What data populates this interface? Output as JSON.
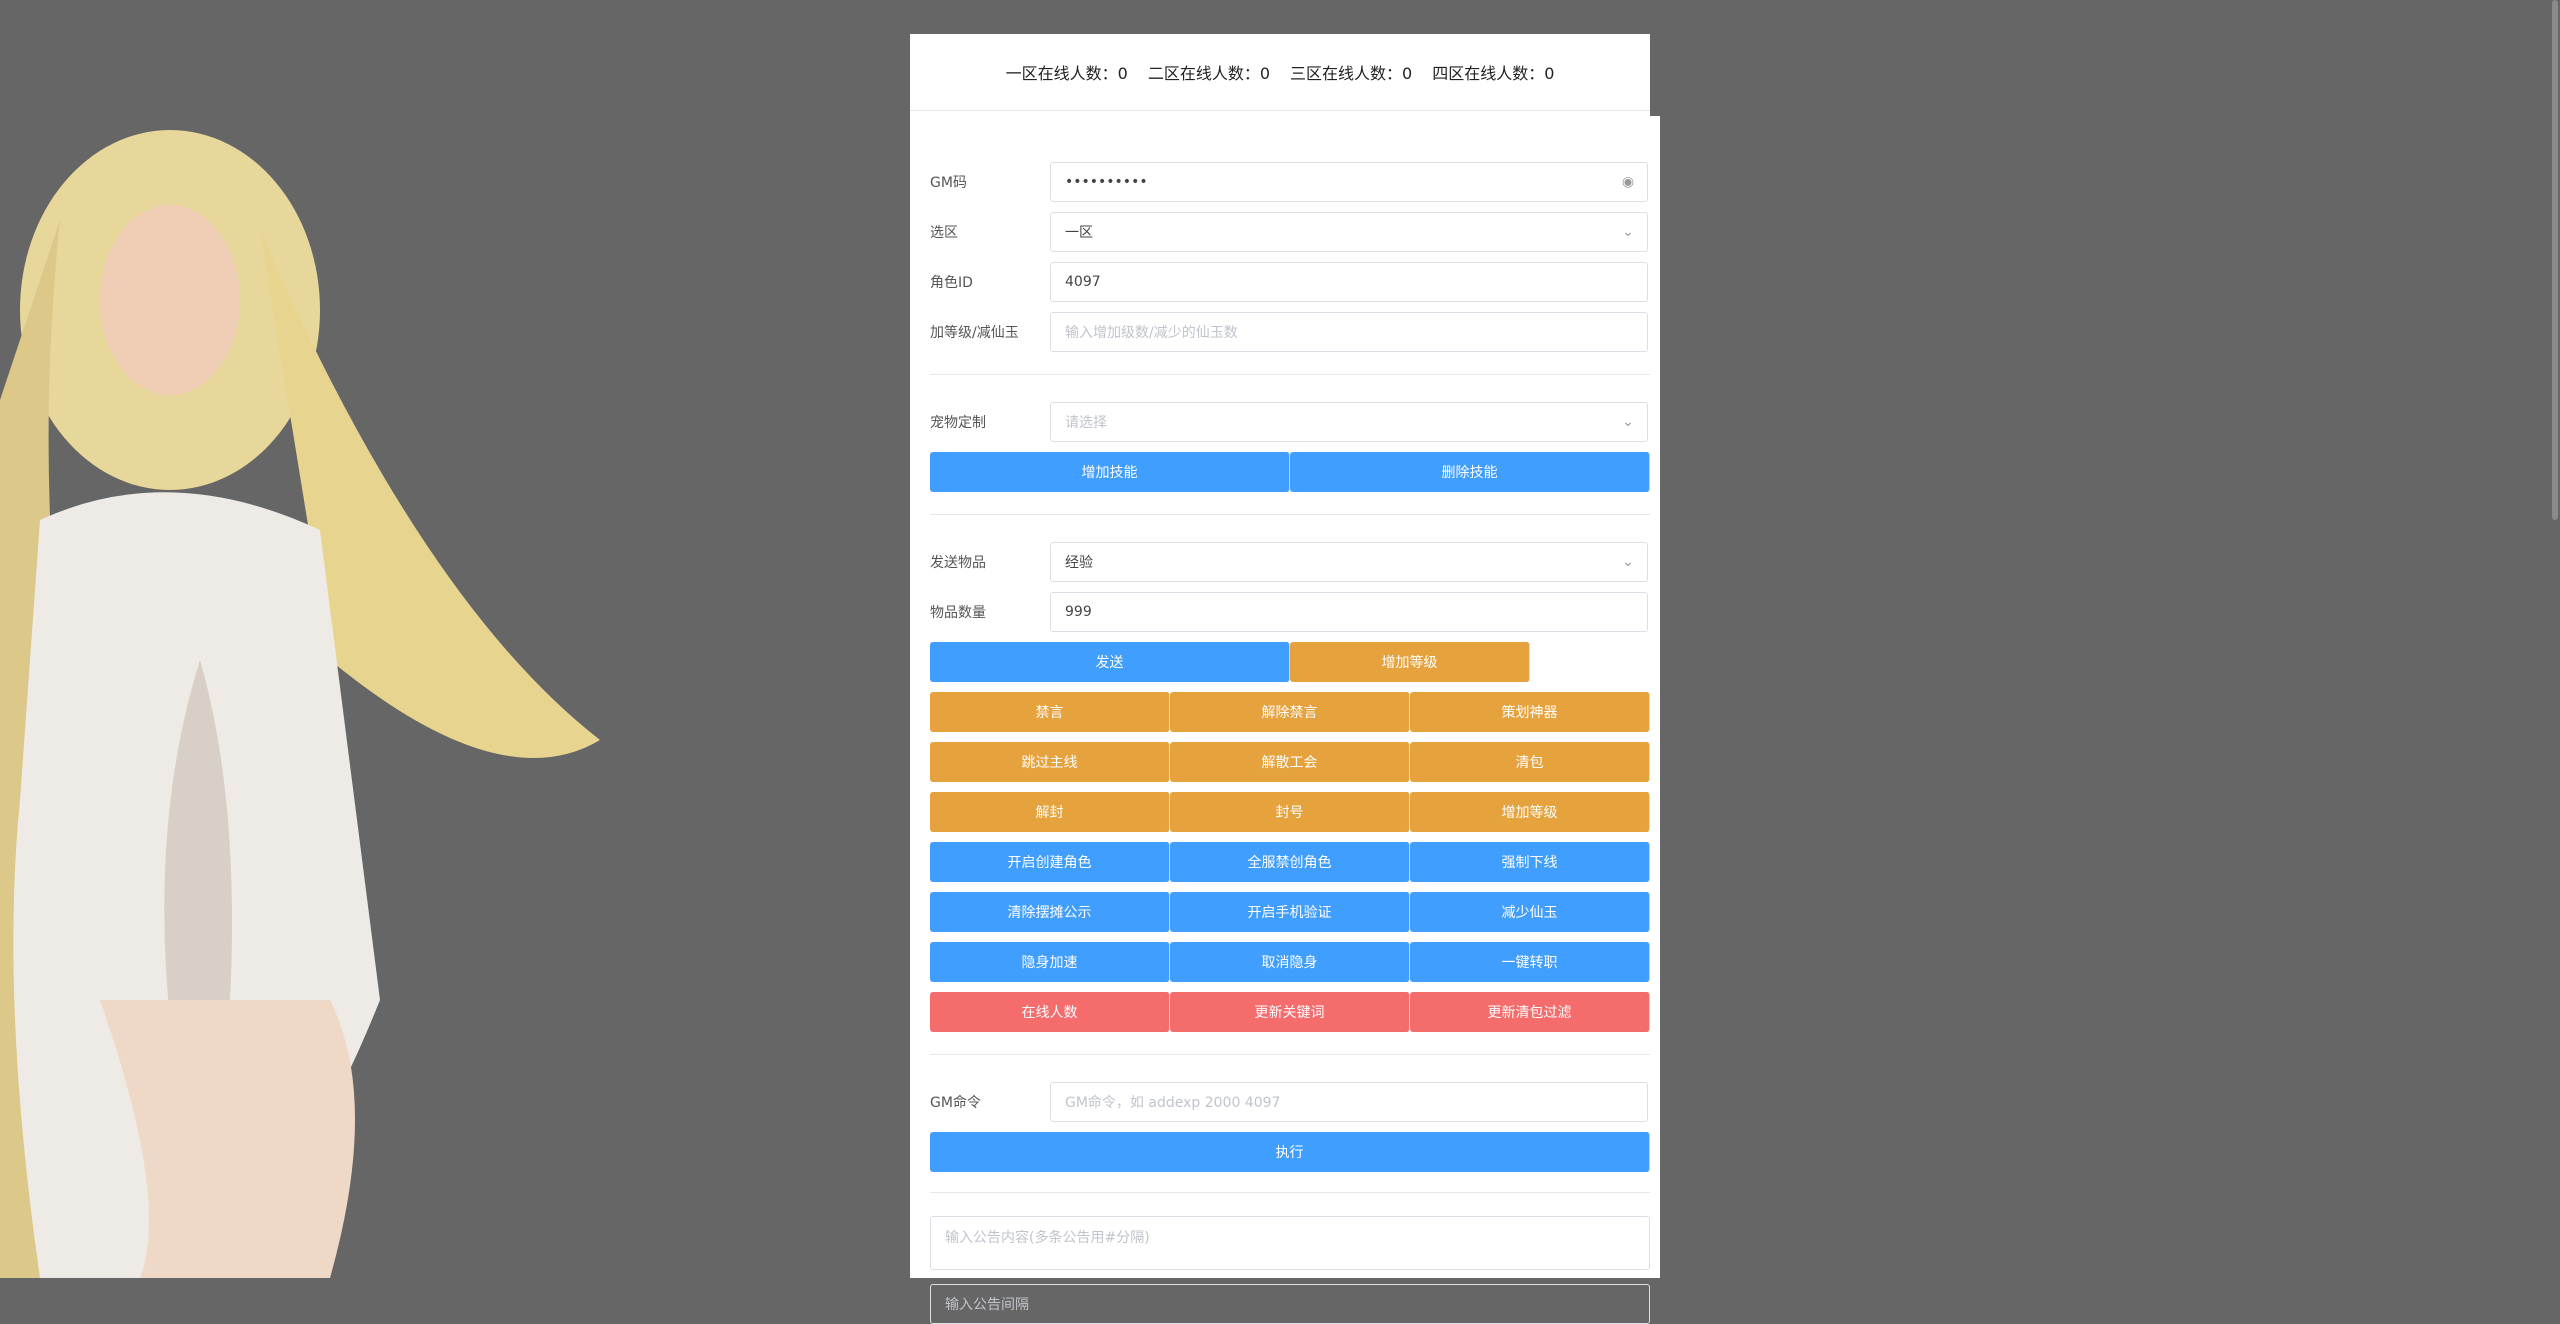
{
  "header": {
    "zone1": "一区在线人数：0",
    "zone2": "二区在线人数：0",
    "zone3": "三区在线人数：0",
    "zone4": "四区在线人数：0"
  },
  "form": {
    "gm_code_label": "GM码",
    "gm_code_value": "••••••••••",
    "zone_label": "选区",
    "zone_value": "一区",
    "role_label": "角色ID",
    "role_value": "4097",
    "level_label": "加等级/减仙玉",
    "level_placeholder": "输入增加级数/减少的仙玉数",
    "pet_label": "宠物定制",
    "pet_placeholder": "请选择",
    "send_item_label": "发送物品",
    "send_item_value": "经验",
    "item_count_label": "物品数量",
    "item_count_value": "999",
    "gm_cmd_label": "GM命令",
    "gm_cmd_placeholder": "GM命令，如 addexp 2000 4097",
    "notice_placeholder": "输入公告内容(多条公告用#分隔)",
    "interval_placeholder": "输入公告间隔"
  },
  "buttons": {
    "add_skill": "增加技能",
    "delete_skill": "删除技能",
    "send": "发送",
    "add_level_top": "增加等级",
    "mute": "禁言",
    "unmute": "解除禁言",
    "plan_artifact": "策划神器",
    "skip_main": "跳过主线",
    "disband_guild": "解散工会",
    "clear_bag": "清包",
    "unban": "解封",
    "ban": "封号",
    "add_level": "增加等级",
    "open_create_role": "开启创建角色",
    "ban_create_role": "全服禁创角色",
    "force_offline": "强制下线",
    "clear_stall": "清除摆摊公示",
    "phone_verify": "开启手机验证",
    "reduce_jade": "减少仙玉",
    "stealth_speed": "隐身加速",
    "cancel_stealth": "取消隐身",
    "one_key_transfer": "一键转职",
    "online_count": "在线人数",
    "update_keywords": "更新关键词",
    "update_filter": "更新清包过滤",
    "execute": "执行"
  },
  "colors": {
    "blue": "#409eff",
    "orange": "#e6a23c",
    "red": "#f56c6c",
    "background": "#666666"
  }
}
